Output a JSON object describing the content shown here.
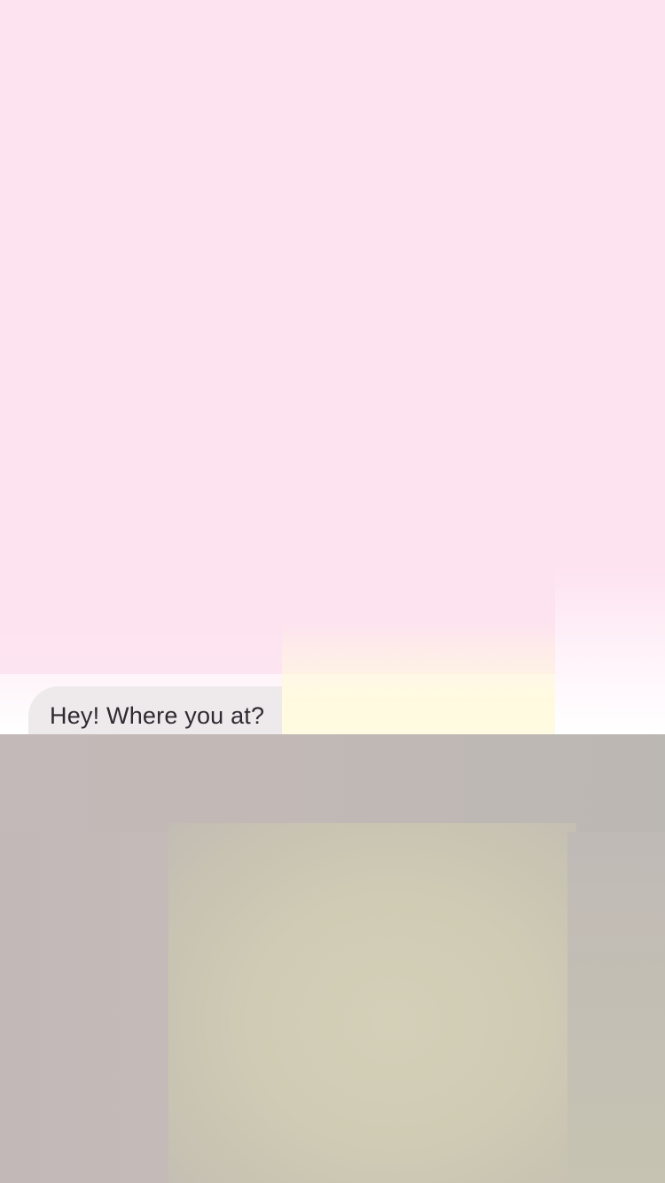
{
  "conversation": {
    "messages": [
      {
        "sender": "incoming",
        "text": "Hey! Where you at? "
      }
    ]
  },
  "colors": {
    "background_pink": "#fde3f0",
    "bubble_incoming": "#eeeaec",
    "overlay_gray": "#bdb6b4",
    "overlay_center": "#d4d0b8"
  }
}
